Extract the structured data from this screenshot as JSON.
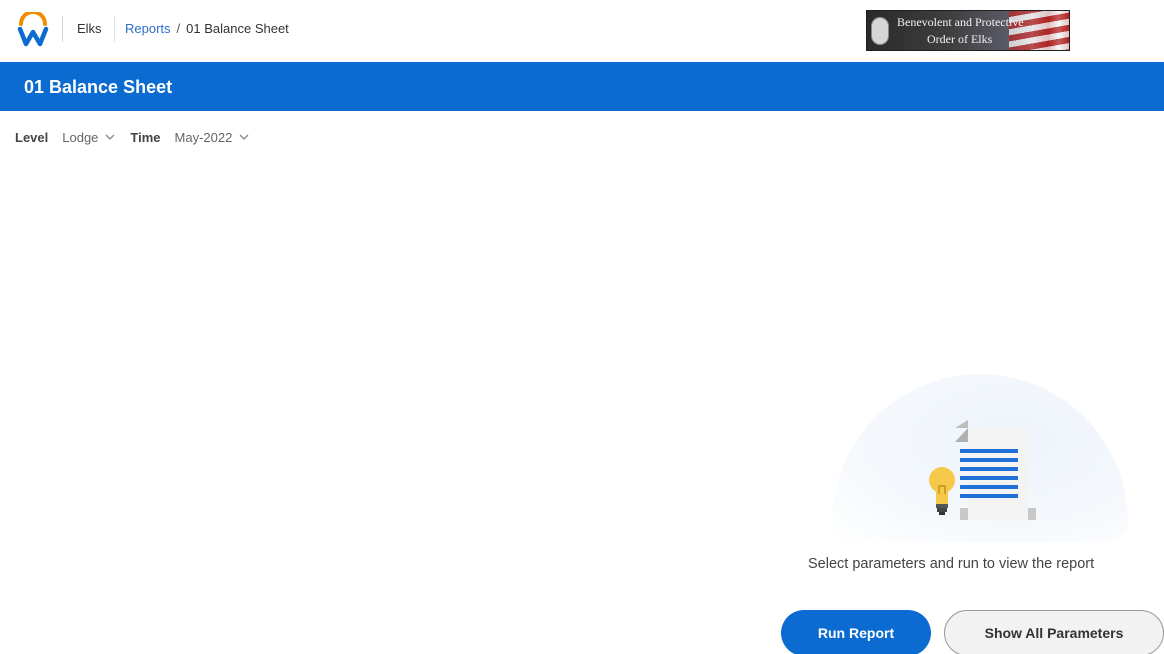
{
  "header": {
    "logo_icon": "workday-logo-icon",
    "org_name": "Elks",
    "breadcrumb": {
      "parent": "Reports",
      "separator": "/",
      "current": "01 Balance Sheet"
    },
    "brand_image": {
      "line1": "Benevolent and Protective",
      "line2": "Order of Elks"
    }
  },
  "title_band": {
    "title": "01 Balance Sheet",
    "color": "#0b6bd0"
  },
  "filters": [
    {
      "label": "Level",
      "value": "Lodge",
      "icon": "chevron-down-icon"
    },
    {
      "label": "Time",
      "value": "May-2022",
      "icon": "chevron-down-icon"
    }
  ],
  "empty_state": {
    "illustration_icon": "report-lightbulb-illustration",
    "message": "Select parameters and run to view the report"
  },
  "actions": {
    "run_label": "Run Report",
    "show_all_label": "Show All Parameters"
  },
  "colors": {
    "accent": "#0b6bd0",
    "link": "#2f6fcb",
    "logo_orange": "#f38b00"
  }
}
